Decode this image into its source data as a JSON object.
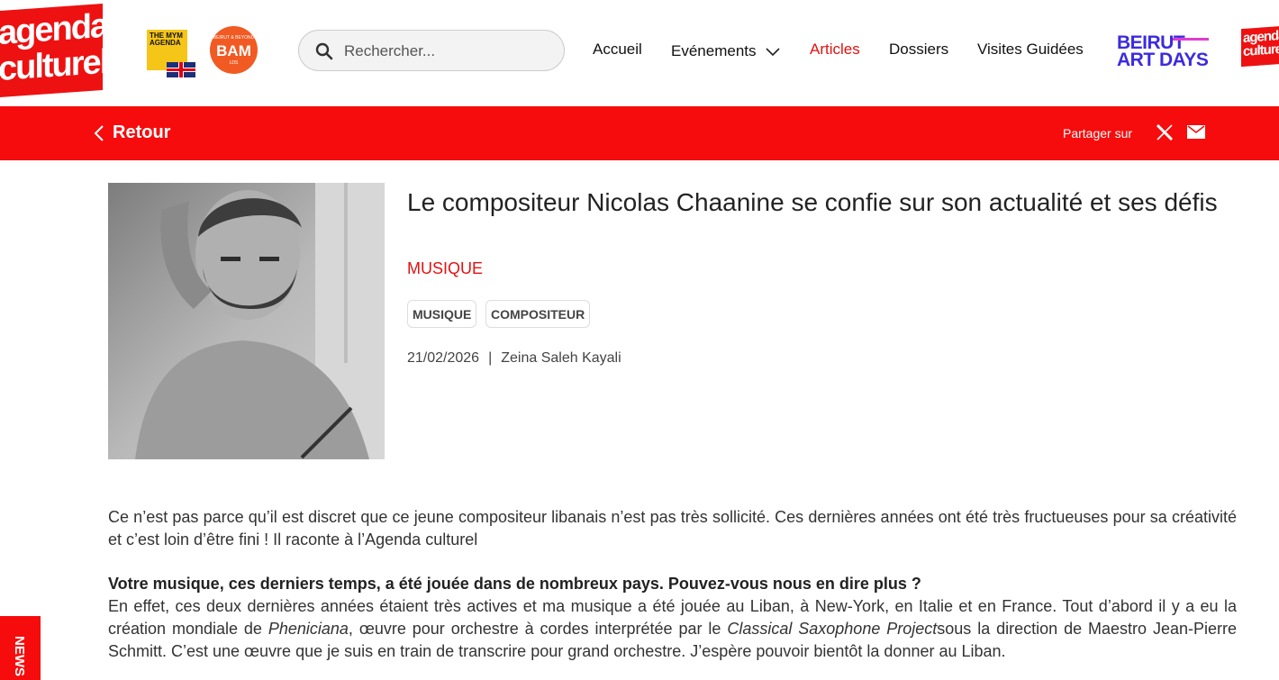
{
  "header": {
    "logo_line1": "agenda",
    "logo_line2": "culturel",
    "mym_text": "THE MYM AGENDA",
    "bam_small": "BEIRUT & BEYOND",
    "bam_big": "BAM",
    "bam_year": "LDS",
    "search_placeholder": "Rechercher...",
    "nav": {
      "accueil": "Accueil",
      "evenements": "Evénements",
      "articles": "Articles",
      "dossiers": "Dossiers",
      "visites": "Visites Guidées"
    },
    "bad_line1": "BEIRUT",
    "bad_line2": "ART DAYS",
    "logo2_line1": "agenda",
    "logo2_line2": "culturel"
  },
  "toolbar": {
    "back_label": "Retour",
    "share_label": "Partager sur"
  },
  "article": {
    "title": "Le compositeur Nicolas Chaanine se confie sur son actualité et ses défis",
    "category": "MUSIQUE",
    "tags": [
      "MUSIQUE",
      "COMPOSITEUR"
    ],
    "date": "21/02/2026",
    "separator": "|",
    "author": "Zeina Saleh Kayali",
    "intro": "Ce n’est pas parce qu’il est discret que ce jeune compositeur libanais n’est pas très sollicité. Ces dernières années ont été très fructueuses pour sa créativité et c’est loin d’être fini ! Il raconte à l’Agenda culturel",
    "question1": "Votre musique, ces derniers temps, a été jouée dans de nombreux pays. Pouvez-vous nous en dire plus ?",
    "answer1_a": "En effet, ces deux dernières années étaient très actives et ma musique a été jouée au Liban, à New-York, en Italie et en France. Tout d’abord il y a eu la création mondiale de ",
    "answer1_work": "Pheniciana",
    "answer1_b": ", œuvre pour orchestre à cordes interprétée par le ",
    "answer1_ensemble": "Classical Saxophone Project",
    "answer1_c": "sous la direction de Maestro Jean-Pierre Schmitt. C’est une œuvre que je suis en train de transcrire pour grand orchestre. J’espère pouvoir bientôt la donner au Liban."
  },
  "side_tab": "NEWS",
  "colors": {
    "brand_red": "#f60c0c",
    "accent_red": "#e31111",
    "bad_blue": "#3b2be0"
  }
}
